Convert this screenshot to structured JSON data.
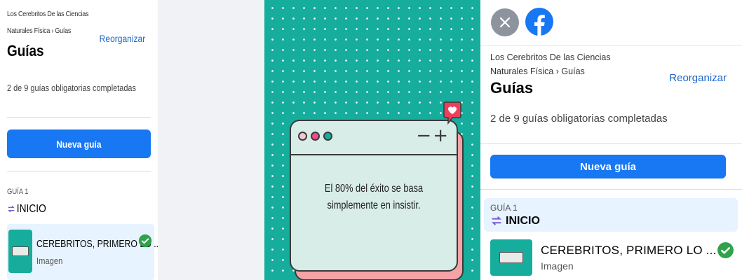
{
  "guides_panel": {
    "breadcrumb_line1": "Los Cerebritos De las Ciencias",
    "breadcrumb_line2": "Naturales Física › Guías",
    "title": "Guías",
    "reorganize_label": "Reorganizar",
    "progress_text": "2 de 9 guías obligatorias completadas",
    "new_guide_label": "Nueva guía",
    "guide": {
      "number": "GUÍA 1",
      "section_title": "INICIO",
      "item_title": "CEREBRITOS, PRIMERO LO ...",
      "item_type": "Imagen",
      "completed": true
    }
  },
  "post_image": {
    "quote_line1": "El 80% del éxito se basa",
    "quote_line2": "simplemente en insistir.",
    "window_controls": "−+"
  },
  "icons": {
    "close": "close-icon",
    "brand": "facebook-icon",
    "check": "check-circle-icon",
    "section": "on-arrows-icon",
    "heart_badge": "heart-notification-icon"
  },
  "colors": {
    "brand_blue": "#1877f2",
    "link_blue": "#1b66c9",
    "success_green": "#31a24c",
    "teal": "#16ad9c",
    "pink": "#f4a3a6",
    "highlight": "#e7f3ff"
  }
}
